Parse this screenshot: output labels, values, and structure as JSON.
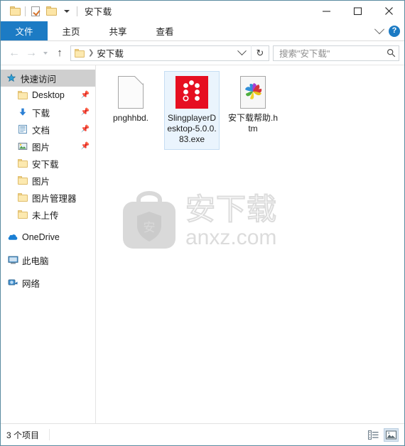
{
  "window": {
    "title": "安下载",
    "quick_access": [
      {
        "name": "new-folder-button",
        "icon": "folder-icon"
      },
      {
        "name": "properties-button",
        "icon": "document-check-icon"
      },
      {
        "name": "folder-button",
        "icon": "folder-icon"
      },
      {
        "name": "customize-qat-button",
        "icon": "caret-down-icon"
      }
    ],
    "controls": {
      "minimize": "minimize-icon",
      "maximize": "maximize-icon",
      "close": "close-icon"
    }
  },
  "ribbon": {
    "tabs": [
      {
        "label": "文件",
        "active": true
      },
      {
        "label": "主页",
        "active": false
      },
      {
        "label": "共享",
        "active": false
      },
      {
        "label": "查看",
        "active": false
      }
    ],
    "expand_icon": "chevron-down-icon",
    "help_label": "?"
  },
  "navbar": {
    "back": "←",
    "forward": "→",
    "up": "↑",
    "breadcrumb": "安下载",
    "breadcrumb_separator": "❯",
    "refresh": "↻"
  },
  "search": {
    "placeholder": "搜索\"安下载\""
  },
  "sidebar": {
    "items": [
      {
        "label": "快速访问",
        "icon": "star-pin-icon",
        "level": "root",
        "selected": true,
        "pinned": false
      },
      {
        "label": "Desktop",
        "icon": "folder-icon",
        "level": "lvl1",
        "selected": false,
        "pinned": true
      },
      {
        "label": "下载",
        "icon": "download-arrow-icon",
        "level": "lvl1",
        "selected": false,
        "pinned": true
      },
      {
        "label": "文档",
        "icon": "documents-icon",
        "level": "lvl1",
        "selected": false,
        "pinned": true
      },
      {
        "label": "图片",
        "icon": "pictures-icon",
        "level": "lvl1",
        "selected": false,
        "pinned": true
      },
      {
        "label": "安下载",
        "icon": "folder-icon",
        "level": "lvl1",
        "selected": false,
        "pinned": false
      },
      {
        "label": "图片",
        "icon": "folder-icon",
        "level": "lvl1",
        "selected": false,
        "pinned": false
      },
      {
        "label": "图片管理器",
        "icon": "folder-icon",
        "level": "lvl1",
        "selected": false,
        "pinned": false
      },
      {
        "label": "未上传",
        "icon": "folder-icon",
        "level": "lvl1",
        "selected": false,
        "pinned": false
      },
      {
        "label": "OneDrive",
        "icon": "onedrive-cloud-icon",
        "level": "lvl0",
        "selected": false,
        "pinned": false
      },
      {
        "label": "此电脑",
        "icon": "this-pc-icon",
        "level": "lvl0",
        "selected": false,
        "pinned": false
      },
      {
        "label": "网络",
        "icon": "network-icon",
        "level": "lvl0",
        "selected": false,
        "pinned": false
      }
    ]
  },
  "files": [
    {
      "label": "pnghhbd.",
      "icon": "blank-document-icon",
      "selected": false
    },
    {
      "label": "SlingplayerDesktop-5.0.0.83.exe",
      "icon": "slingplayer-app-icon",
      "selected": true
    },
    {
      "label": "安下载帮助.htm",
      "icon": "html-document-icon",
      "selected": false
    }
  ],
  "watermark": {
    "outline_text": "安下载",
    "site_text": "anxz.com",
    "badge_text": "安"
  },
  "statusbar": {
    "item_count": "3 个项目",
    "views": [
      {
        "name": "details-view-button",
        "active": false
      },
      {
        "name": "large-icons-view-button",
        "active": true
      }
    ]
  },
  "colors": {
    "accent": "#1c7bc4",
    "selection_fill": "#eaf4fd",
    "selection_border": "#c5ddf3",
    "sling_red": "#e60f21",
    "window_border": "#5a8ba0"
  }
}
